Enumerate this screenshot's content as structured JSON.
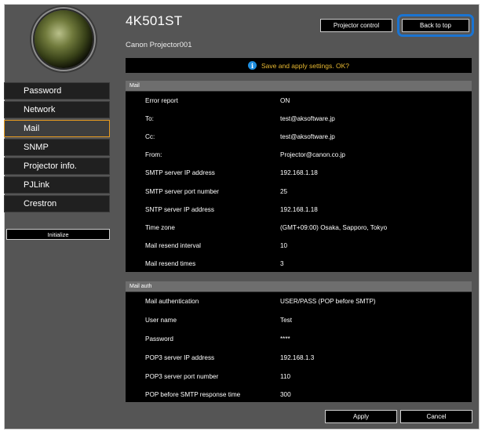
{
  "header": {
    "model": "4K501ST",
    "device_name": "Canon Projector001",
    "projector_control": "Projector control",
    "back_to_top": "Back to top"
  },
  "notice": {
    "message": "Save and apply settings. OK?",
    "icon": "info-icon",
    "icon_glyph": "i"
  },
  "menu": {
    "items": [
      {
        "label": "Password"
      },
      {
        "label": "Network"
      },
      {
        "label": "Mail"
      },
      {
        "label": "SNMP"
      },
      {
        "label": "Projector info."
      },
      {
        "label": "PJLink"
      },
      {
        "label": "Crestron"
      }
    ],
    "active": "Mail",
    "initialize": "Initialize"
  },
  "mail": {
    "title": "Mail",
    "rows": [
      {
        "label": "Error report",
        "value": "ON"
      },
      {
        "label": "To:",
        "value": "test@aksoftware.jp"
      },
      {
        "label": "Cc:",
        "value": "test@aksoftware.jp"
      },
      {
        "label": "From:",
        "value": "Projector@canon.co.jp"
      },
      {
        "label": "SMTP server IP address",
        "value": "192.168.1.18"
      },
      {
        "label": "SMTP server port number",
        "value": "25"
      },
      {
        "label": "SNTP server IP address",
        "value": "192.168.1.18"
      },
      {
        "label": "Time zone",
        "value": "(GMT+09:00) Osaka, Sapporo, Tokyo"
      },
      {
        "label": "Mail resend interval",
        "value": "10"
      },
      {
        "label": "Mail resend times",
        "value": "3"
      }
    ]
  },
  "mail_auth": {
    "title": "Mail auth",
    "rows": [
      {
        "label": "Mail authentication",
        "value": "USER/PASS (POP before SMTP)"
      },
      {
        "label": "User name",
        "value": "Test"
      },
      {
        "label": "Password",
        "value": "****"
      },
      {
        "label": "POP3 server IP address",
        "value": "192.168.1.3"
      },
      {
        "label": "POP3 server port number",
        "value": "110"
      },
      {
        "label": "POP before SMTP response time",
        "value": "300"
      }
    ]
  },
  "footer": {
    "apply": "Apply",
    "cancel": "Cancel"
  },
  "colors": {
    "accent_border": "#e59a20",
    "highlight_outline": "#1a74d2",
    "notice_text": "#e8b931"
  }
}
